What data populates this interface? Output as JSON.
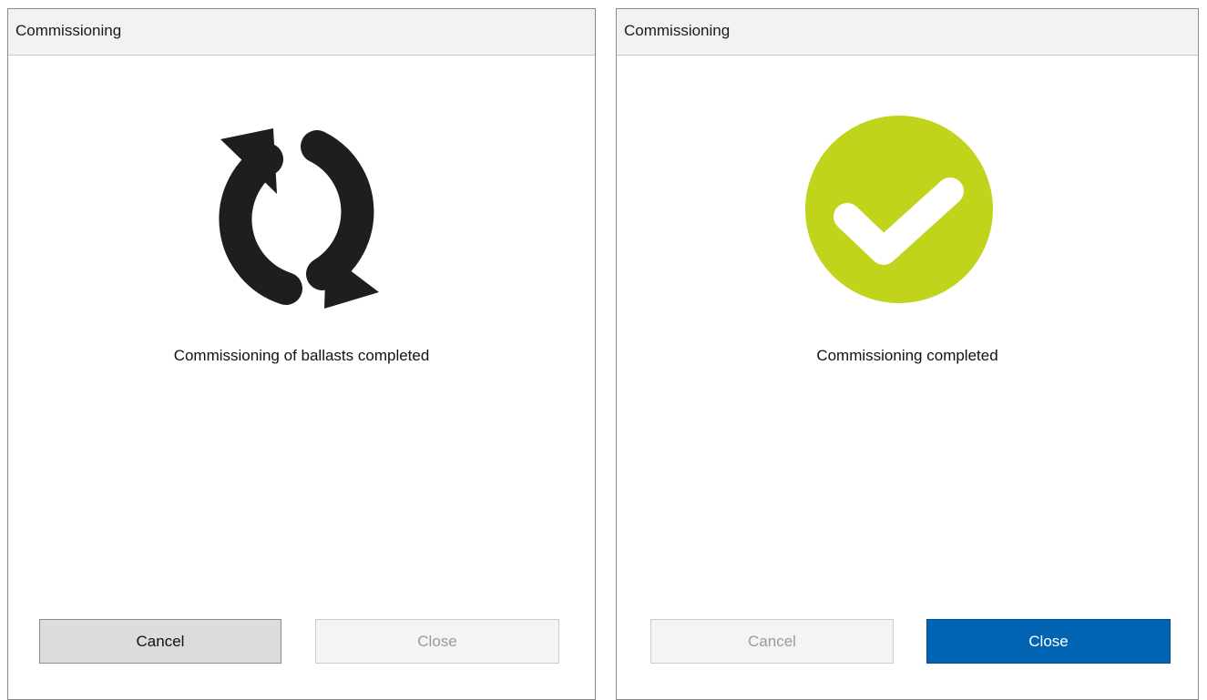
{
  "dialogs": {
    "left": {
      "title": "Commissioning",
      "icon": "refresh-icon",
      "icon_color": "#1e1e1e",
      "message": "Commissioning of ballasts completed",
      "buttons": {
        "cancel": {
          "label": "Cancel",
          "state": "enabled"
        },
        "close": {
          "label": "Close",
          "state": "disabled"
        }
      }
    },
    "right": {
      "title": "Commissioning",
      "icon": "check-circle-icon",
      "icon_color": "#bfd41b",
      "message": "Commissioning completed",
      "buttons": {
        "cancel": {
          "label": "Cancel",
          "state": "disabled"
        },
        "close": {
          "label": "Close",
          "state": "primary",
          "color": "#0064b3"
        }
      }
    }
  }
}
